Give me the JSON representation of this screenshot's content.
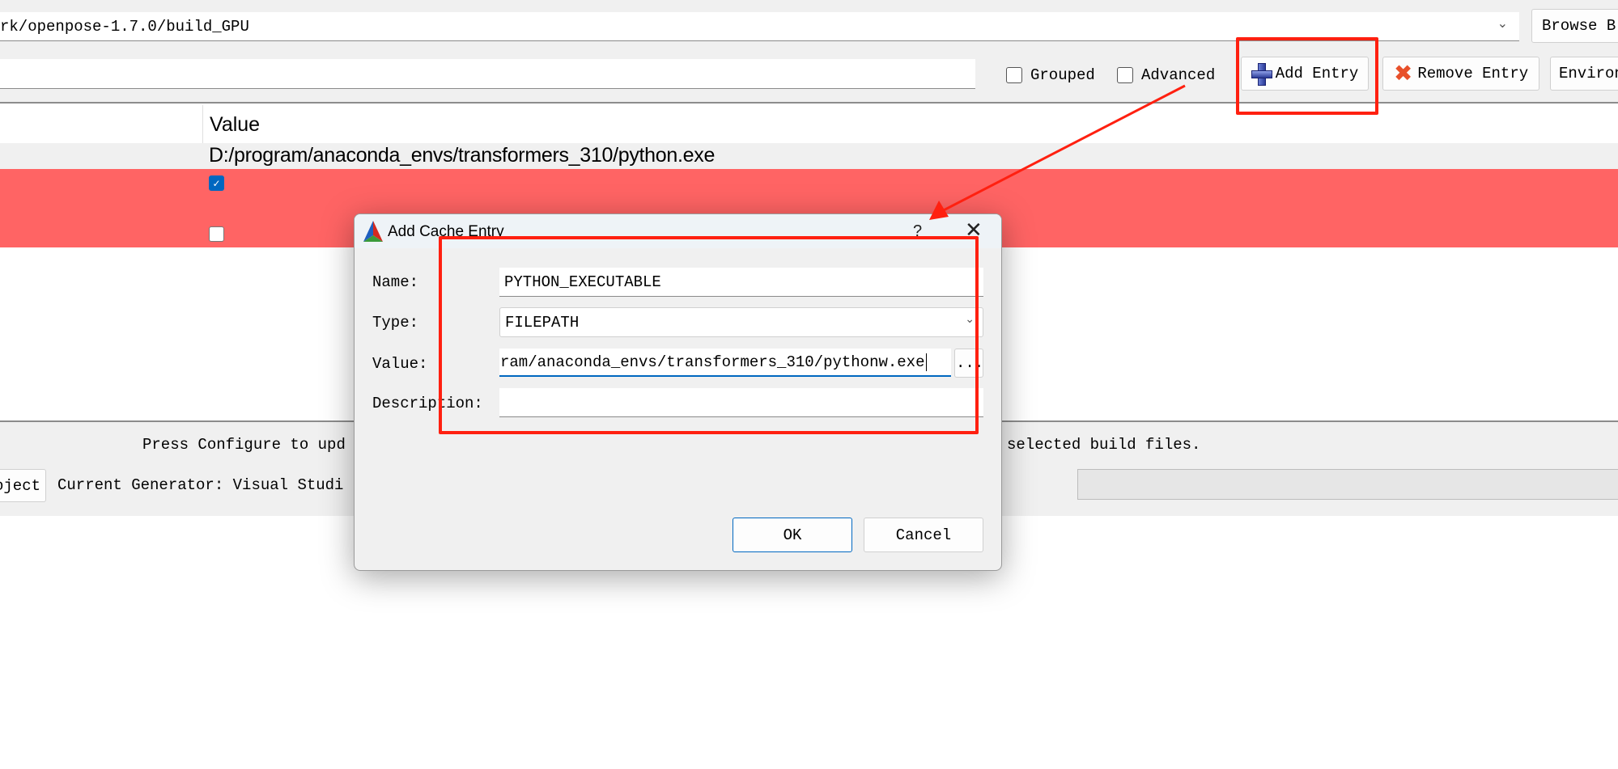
{
  "toolbar": {
    "build_path": "rk/openpose-1.7.0/build_GPU",
    "browse_build_label": "Browse B",
    "search_value": "",
    "grouped_label": "Grouped",
    "grouped_checked": false,
    "advanced_label": "Advanced",
    "advanced_checked": false,
    "add_entry_label": "Add Entry",
    "remove_entry_label": "Remove Entry",
    "environment_label": "Environ"
  },
  "table": {
    "columns": [
      "",
      "Value"
    ],
    "rows": [
      {
        "value": "D:/program/anaconda_envs/transformers_310/python.exe",
        "new": false
      },
      {
        "value_checkbox": true,
        "new": true
      },
      {
        "value_checkbox": false,
        "new": true
      }
    ]
  },
  "status": {
    "message_left": "Press Configure to upd",
    "message_right": "selected build files.",
    "project_button_label": "oject",
    "generator_label": "Current Generator: Visual Studi"
  },
  "dialog": {
    "title": "Add Cache Entry",
    "help_label": "?",
    "name_label": "Name:",
    "name_value": "PYTHON_EXECUTABLE",
    "type_label": "Type:",
    "type_value": "FILEPATH",
    "value_label": "Value:",
    "value_value": "ram/anaconda_envs/transformers_310/pythonw.exe",
    "browse_label": "...",
    "description_label": "Description:",
    "description_value": "",
    "ok_label": "OK",
    "cancel_label": "Cancel"
  },
  "colors": {
    "new_entry_row": "#ff6464",
    "annotation": "#ff2010",
    "accent": "#0067c0"
  }
}
